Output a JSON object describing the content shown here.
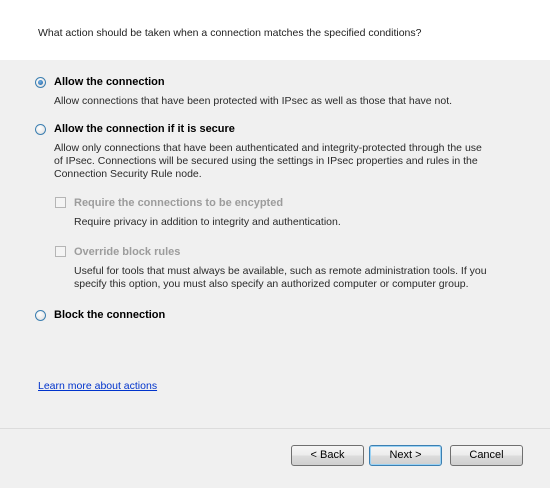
{
  "question": "What action should be taken when a connection matches the specified conditions?",
  "options": [
    {
      "label": "Allow the connection",
      "description": "Allow connections that have been protected with IPsec as well as those that have not.",
      "selected": true
    },
    {
      "label": "Allow the connection if it is secure",
      "description_lines": [
        "Allow only connections that have been authenticated and integrity-protected through the use",
        "of IPsec.  Connections will be secured using the settings in IPsec properties and rules in the",
        "Connection Security Rule node."
      ],
      "selected": false,
      "sub_options": [
        {
          "label": "Require the connections to be encypted",
          "description": "Require privacy in addition to integrity and authentication.",
          "checked": false,
          "enabled": false
        },
        {
          "label": "Override block rules",
          "description_lines": [
            "Useful for tools that must always be available, such as remote administration tools.  If you",
            "specify this option, you must also specify an authorized computer or computer group."
          ],
          "checked": false,
          "enabled": false
        }
      ]
    },
    {
      "label": "Block the connection",
      "selected": false
    }
  ],
  "learn_more_link": "Learn more about actions",
  "buttons": {
    "back": "< Back",
    "next": "Next >",
    "cancel": "Cancel"
  }
}
